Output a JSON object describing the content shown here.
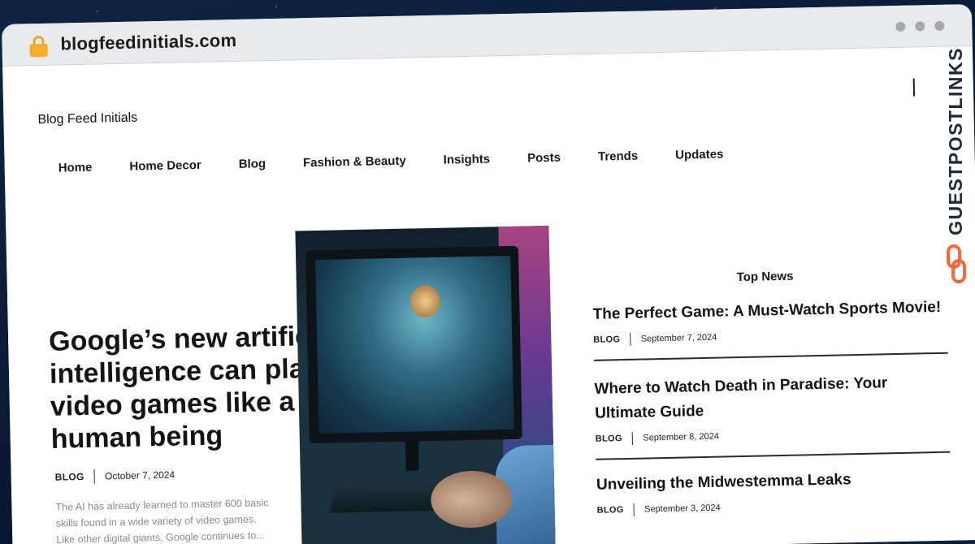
{
  "browser": {
    "url": "blogfeedinitials.com"
  },
  "site": {
    "title": "Blog Feed Initials"
  },
  "nav": {
    "items": [
      "Home",
      "Home Decor",
      "Blog",
      "Fashion & Beauty",
      "Insights",
      "Posts",
      "Trends",
      "Updates"
    ]
  },
  "hero": {
    "title": "Google’s new artificial intelligence can play video games like a human being",
    "category": "BLOG",
    "date": "October 7, 2024",
    "excerpt": "The AI has already learned to master 600 basic skills found in a wide variety of video games. Like other digital giants, Google continues to..."
  },
  "top_news": {
    "heading": "Top News",
    "items": [
      {
        "title": "The Perfect Game: A Must-Watch Sports Movie!",
        "category": "BLOG",
        "date": "September 7, 2024"
      },
      {
        "title": "Where to Watch Death in Paradise: Your Ultimate Guide",
        "category": "BLOG",
        "date": "September 8, 2024"
      },
      {
        "title": "Unveiling the Midwestemma Leaks",
        "category": "BLOG",
        "date": "September 3, 2024"
      }
    ]
  },
  "watermark": {
    "text": "GUESTPOSTLINKS",
    "accent": "#f26a3d"
  }
}
